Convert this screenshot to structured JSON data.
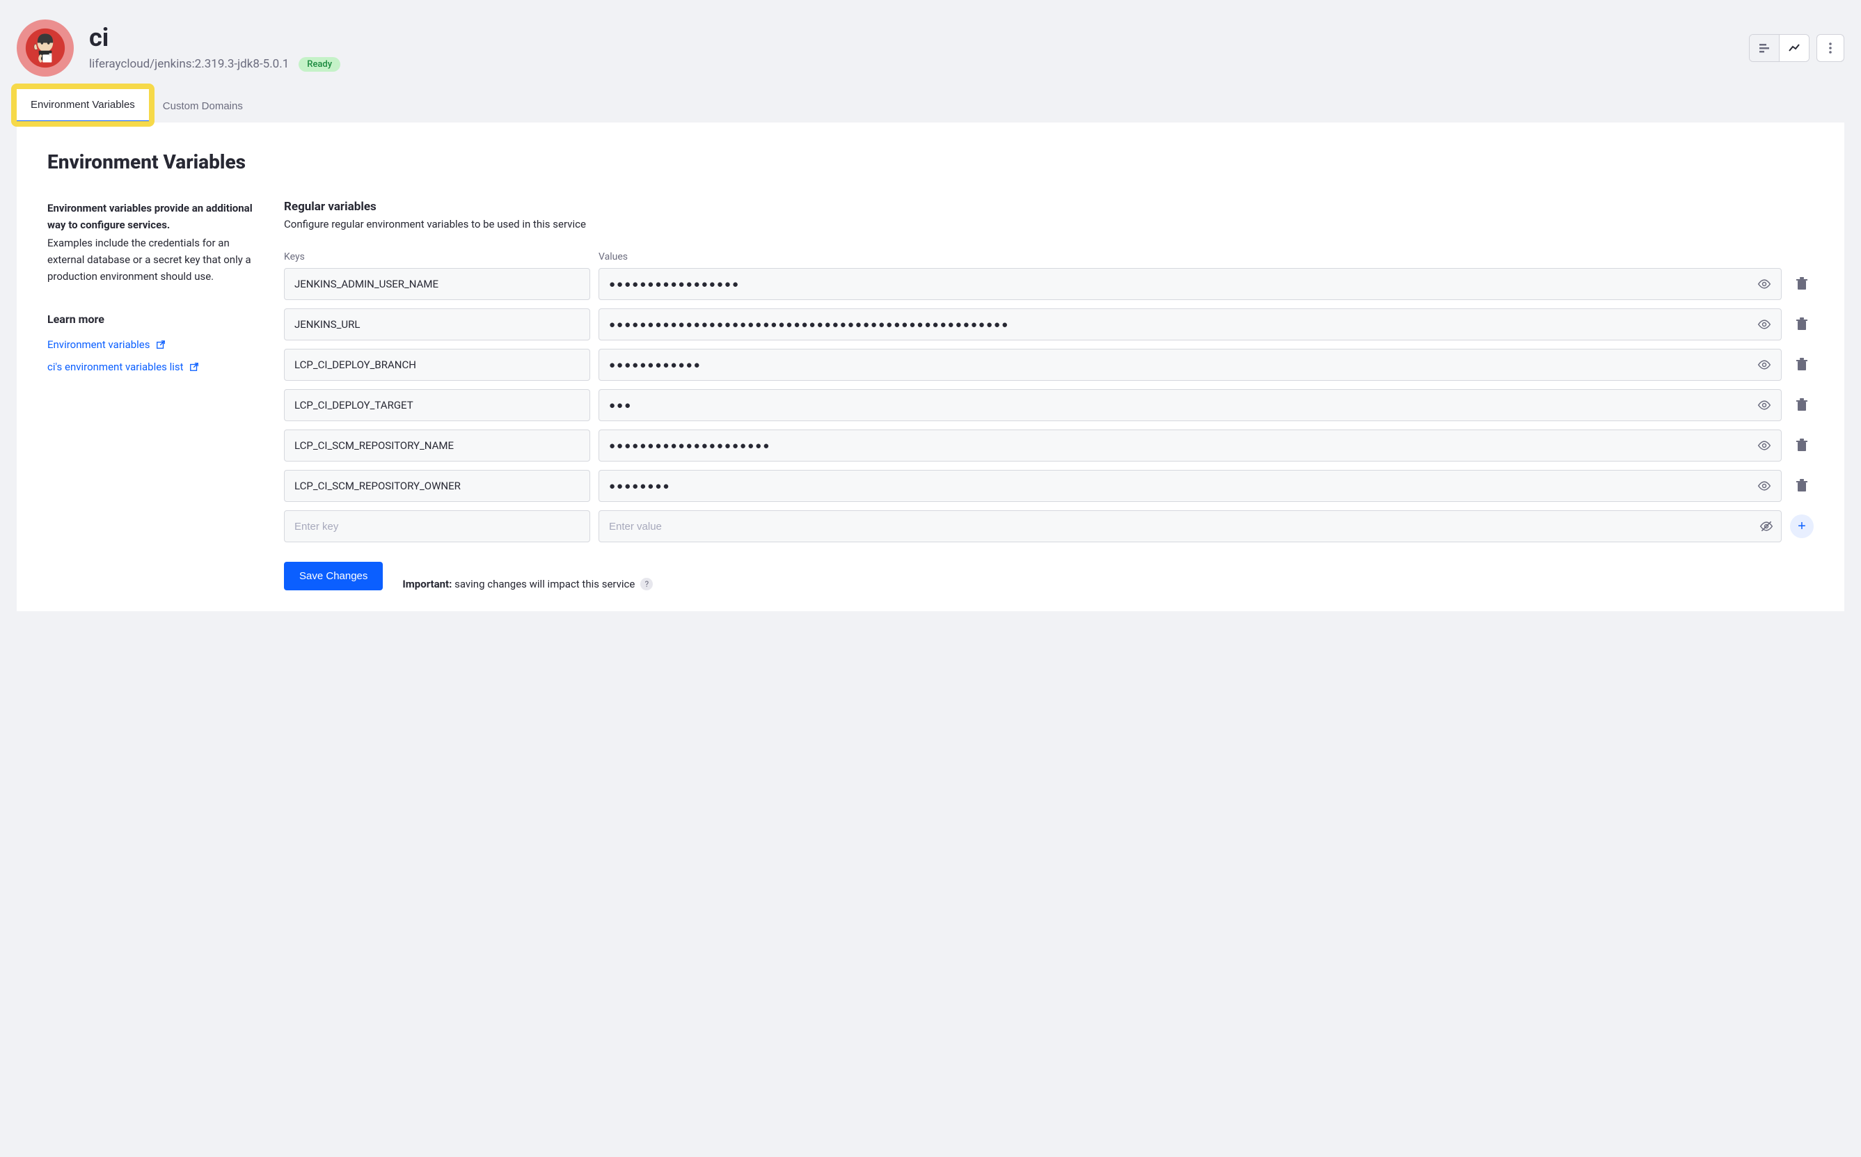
{
  "header": {
    "title": "ci",
    "subtitle": "liferaycloud/jenkins:2.319.3-jdk8-5.0.1",
    "status": "Ready"
  },
  "tabs": {
    "env": "Environment Variables",
    "domains": "Custom Domains"
  },
  "panel": {
    "title": "Environment Variables",
    "intro_strong": "Environment variables provide an additional way to configure services.",
    "intro_text": "Examples include the credentials for an external database or a secret key that only a production environment should use.",
    "learn_more_title": "Learn more",
    "links": {
      "env_vars": "Environment variables",
      "ci_list": "ci's environment variables list"
    },
    "section_title": "Regular variables",
    "section_desc": "Configure regular environment variables to be used in this service",
    "col_keys": "Keys",
    "col_values": "Values",
    "vars": [
      {
        "key": "JENKINS_ADMIN_USER_NAME",
        "mask": "●●●●●●●●●●●●●●●●●"
      },
      {
        "key": "JENKINS_URL",
        "mask": "●●●●●●●●●●●●●●●●●●●●●●●●●●●●●●●●●●●●●●●●●●●●●●●●●●●●"
      },
      {
        "key": "LCP_CI_DEPLOY_BRANCH",
        "mask": "●●●●●●●●●●●●"
      },
      {
        "key": "LCP_CI_DEPLOY_TARGET",
        "mask": "●●●"
      },
      {
        "key": "LCP_CI_SCM_REPOSITORY_NAME",
        "mask": "●●●●●●●●●●●●●●●●●●●●●"
      },
      {
        "key": "LCP_CI_SCM_REPOSITORY_OWNER",
        "mask": "●●●●●●●●"
      }
    ],
    "placeholder_key": "Enter key",
    "placeholder_value": "Enter value",
    "save_label": "Save Changes",
    "important_label": "Important:",
    "important_text": " saving changes will impact this service"
  }
}
